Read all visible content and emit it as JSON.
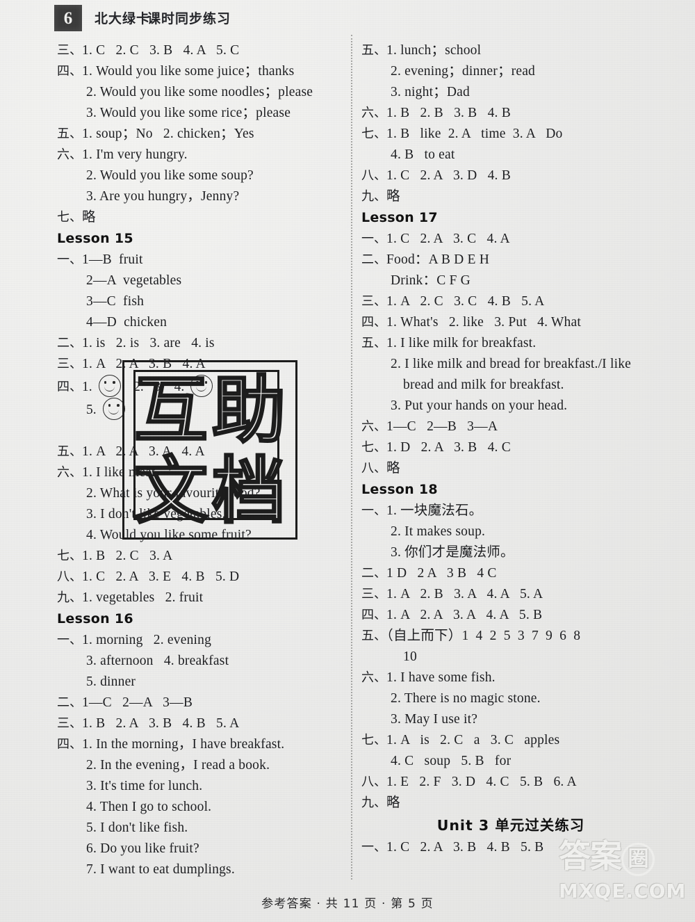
{
  "header": {
    "grade_badge": "6",
    "brand": "北大绿卡",
    "doc_title": "课时同步练习"
  },
  "footer": {
    "text": "参考答案 · 共 11 页 · 第 5 页"
  },
  "watermarks": {
    "stamp_chars": [
      "互",
      "助",
      "文",
      "档"
    ],
    "site_cn": "答案",
    "site_cn_circle": "圈",
    "site_domain": "MXQE.COM"
  },
  "left_column": [
    {
      "type": "answer",
      "label": "三、",
      "text": "1. C   2. C   3. B   4. A   5. C"
    },
    {
      "type": "answer",
      "label": "四、",
      "text": "1. Would you like some juice；thanks"
    },
    {
      "type": "cont1",
      "label": "",
      "text": "2. Would you like some noodles；please"
    },
    {
      "type": "cont1",
      "label": "",
      "text": "3. Would you like some rice；please"
    },
    {
      "type": "answer",
      "label": "五、",
      "text": "1. soup；No   2. chicken；Yes"
    },
    {
      "type": "answer",
      "label": "六、",
      "text": "1. I'm very hungry."
    },
    {
      "type": "cont1",
      "label": "",
      "text": "2. Would you like some soup?"
    },
    {
      "type": "cont1",
      "label": "",
      "text": "3. Are you hungry，Jenny?"
    },
    {
      "type": "answer",
      "label": "七、",
      "text": "略"
    },
    {
      "type": "lesson",
      "label": "",
      "text": "Lesson 15"
    },
    {
      "type": "answer",
      "label": "一、",
      "text": "1—B  fruit"
    },
    {
      "type": "cont1",
      "label": "",
      "text": "2—A  vegetables"
    },
    {
      "type": "cont1",
      "label": "",
      "text": "3—C  fish"
    },
    {
      "type": "cont1",
      "label": "",
      "text": "4—D  chicken"
    },
    {
      "type": "answer",
      "label": "二、",
      "text": "1. is   2. is   3. are   4. is"
    },
    {
      "type": "answer",
      "label": "三、",
      "text": "1. A   2. A   3. B   4. A"
    },
    {
      "type": "smiley",
      "label": "四、",
      "text": "1.",
      "text2": "5.",
      "faces": 2
    },
    {
      "type": "answer",
      "label": "五、",
      "text": "1. A   2. A   3. A   4. A"
    },
    {
      "type": "answer",
      "label": "六、",
      "text": "1. I like meat."
    },
    {
      "type": "cont1",
      "label": "",
      "text": "2. What is your favourite food?"
    },
    {
      "type": "cont1",
      "label": "",
      "text": "3. I don't like vegetables."
    },
    {
      "type": "cont1",
      "label": "",
      "text": "4. Would you like some fruit?"
    },
    {
      "type": "answer",
      "label": "七、",
      "text": "1. B   2. C   3. A"
    },
    {
      "type": "answer",
      "label": "八、",
      "text": "1. C   2. A   3. E   4. B   5. D"
    },
    {
      "type": "answer",
      "label": "九、",
      "text": "1. vegetables   2. fruit"
    },
    {
      "type": "lesson",
      "label": "",
      "text": "Lesson 16"
    },
    {
      "type": "answer",
      "label": "一、",
      "text": "1. morning   2. evening"
    },
    {
      "type": "cont1",
      "label": "",
      "text": "3. afternoon   4. breakfast"
    },
    {
      "type": "cont1",
      "label": "",
      "text": "5. dinner"
    },
    {
      "type": "answer",
      "label": "二、",
      "text": "1—C   2—A   3—B"
    },
    {
      "type": "answer",
      "label": "三、",
      "text": "1. B   2. A   3. B   4. B   5. A"
    },
    {
      "type": "answer",
      "label": "四、",
      "text": "1. In the morning，I have breakfast."
    },
    {
      "type": "cont1",
      "label": "",
      "text": "2. In the evening，I read a book."
    },
    {
      "type": "cont1",
      "label": "",
      "text": "3. It's time for lunch."
    },
    {
      "type": "cont1",
      "label": "",
      "text": "4. Then I go to school."
    },
    {
      "type": "cont1",
      "label": "",
      "text": "5. I don't like fish."
    },
    {
      "type": "cont1",
      "label": "",
      "text": "6. Do you like fruit?"
    },
    {
      "type": "cont1",
      "label": "",
      "text": "7. I want to eat dumplings."
    }
  ],
  "right_column": [
    {
      "type": "answer",
      "label": "五、",
      "text": "1. lunch；school"
    },
    {
      "type": "cont1",
      "label": "",
      "text": "2. evening；dinner；read"
    },
    {
      "type": "cont1",
      "label": "",
      "text": "3. night；Dad"
    },
    {
      "type": "answer",
      "label": "六、",
      "text": "1. B   2. B   3. B   4. B"
    },
    {
      "type": "answer",
      "label": "七、",
      "text": "1. B   like  2. A   time  3. A   Do"
    },
    {
      "type": "cont1",
      "label": "",
      "text": "4. B   to eat"
    },
    {
      "type": "answer",
      "label": "八、",
      "text": "1. C   2. A   3. D   4. B"
    },
    {
      "type": "answer",
      "label": "九、",
      "text": "略"
    },
    {
      "type": "lesson",
      "label": "",
      "text": "Lesson 17"
    },
    {
      "type": "answer",
      "label": "一、",
      "text": "1. C   2. A   3. C   4. A"
    },
    {
      "type": "answer",
      "label": "二、",
      "text": "Food：A B D E H"
    },
    {
      "type": "cont1",
      "label": "",
      "text": "Drink：C F G"
    },
    {
      "type": "answer",
      "label": "三、",
      "text": "1. A   2. C   3. C   4. B   5. A"
    },
    {
      "type": "answer",
      "label": "四、",
      "text": "1. What's   2. like   3. Put   4. What"
    },
    {
      "type": "answer",
      "label": "五、",
      "text": "1. I like milk for breakfast."
    },
    {
      "type": "cont1",
      "label": "",
      "text": "2. I like milk and bread for breakfast./I like"
    },
    {
      "type": "cont2",
      "label": "",
      "text": "bread and milk for breakfast."
    },
    {
      "type": "cont1",
      "label": "",
      "text": "3. Put your hands on your head."
    },
    {
      "type": "answer",
      "label": "六、",
      "text": "1—C   2—B   3—A"
    },
    {
      "type": "answer",
      "label": "七、",
      "text": "1. D   2. A   3. B   4. C"
    },
    {
      "type": "answer",
      "label": "八、",
      "text": "略"
    },
    {
      "type": "lesson",
      "label": "",
      "text": "Lesson 18"
    },
    {
      "type": "answer",
      "label": "一、",
      "text": "1. 一块魔法石。"
    },
    {
      "type": "cont1",
      "label": "",
      "text": "2. It makes soup."
    },
    {
      "type": "cont1",
      "label": "",
      "text": "3. 你们才是魔法师。"
    },
    {
      "type": "answer",
      "label": "二、",
      "text": "1 D   2 A   3 B   4 C"
    },
    {
      "type": "answer",
      "label": "三、",
      "text": "1. A   2. B   3. A   4. A   5. A"
    },
    {
      "type": "answer",
      "label": "四、",
      "text": "1. A   2. A   3. A   4. A   5. B"
    },
    {
      "type": "answer",
      "label": "五、",
      "text": "（自上而下）1  4  2  5  3  7  9  6  8"
    },
    {
      "type": "cont2",
      "label": "",
      "text": "10"
    },
    {
      "type": "answer",
      "label": "六、",
      "text": "1. I have some fish."
    },
    {
      "type": "cont1",
      "label": "",
      "text": "2. There is no magic stone."
    },
    {
      "type": "cont1",
      "label": "",
      "text": "3. May I use it?"
    },
    {
      "type": "answer",
      "label": "七、",
      "text": "1. A   is   2. C   a   3. C   apples"
    },
    {
      "type": "cont1",
      "label": "",
      "text": "4. C   soup   5. B   for"
    },
    {
      "type": "answer",
      "label": "八、",
      "text": "1. E   2. F   3. D   4. C   5. B   6. A"
    },
    {
      "type": "answer",
      "label": "九、",
      "text": "略"
    },
    {
      "type": "unit",
      "label": "",
      "text": "Unit 3    单元过关练习"
    },
    {
      "type": "answer",
      "label": "一、",
      "text": "1. C   2. A   3. B   4. B   5. B"
    }
  ]
}
